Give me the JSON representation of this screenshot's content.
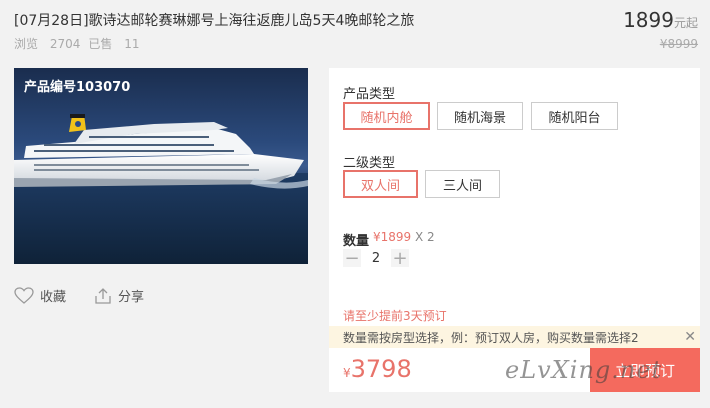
{
  "product": {
    "title": "[07月28日]歌诗达邮轮赛琳娜号上海往返鹿儿岛5天4晚邮轮之旅",
    "views_label": "浏览",
    "views": "2704",
    "sold_label": "已售",
    "sold": "11",
    "price": "1899",
    "price_unit": "元起",
    "old_price": "¥8999",
    "product_code": "产品编号103070"
  },
  "actions": {
    "favorite": "收藏",
    "share": "分享"
  },
  "options": {
    "type_label": "产品类型",
    "types": [
      "随机内舱",
      "随机海景",
      "随机阳台"
    ],
    "subtype_label": "二级类型",
    "subtypes": [
      "双人间",
      "三人间"
    ]
  },
  "quantity": {
    "label": "数量",
    "unit_price": "¥1899",
    "multiplier": "X 2",
    "value": "2",
    "minus": "−",
    "plus": "+"
  },
  "notice": "请至少提前3天预订",
  "tooltip": "数量需按房型选择，例：预订双人房，购买数量需选择2",
  "tooltip_close": "✕",
  "total": {
    "currency": "¥",
    "amount": "3798"
  },
  "book_button": "立即预订",
  "watermark": "eLvXing.net",
  "colors": {
    "accent": "#e8736a",
    "button": "#f46a5e",
    "tooltip_bg": "#fdf5e1"
  }
}
